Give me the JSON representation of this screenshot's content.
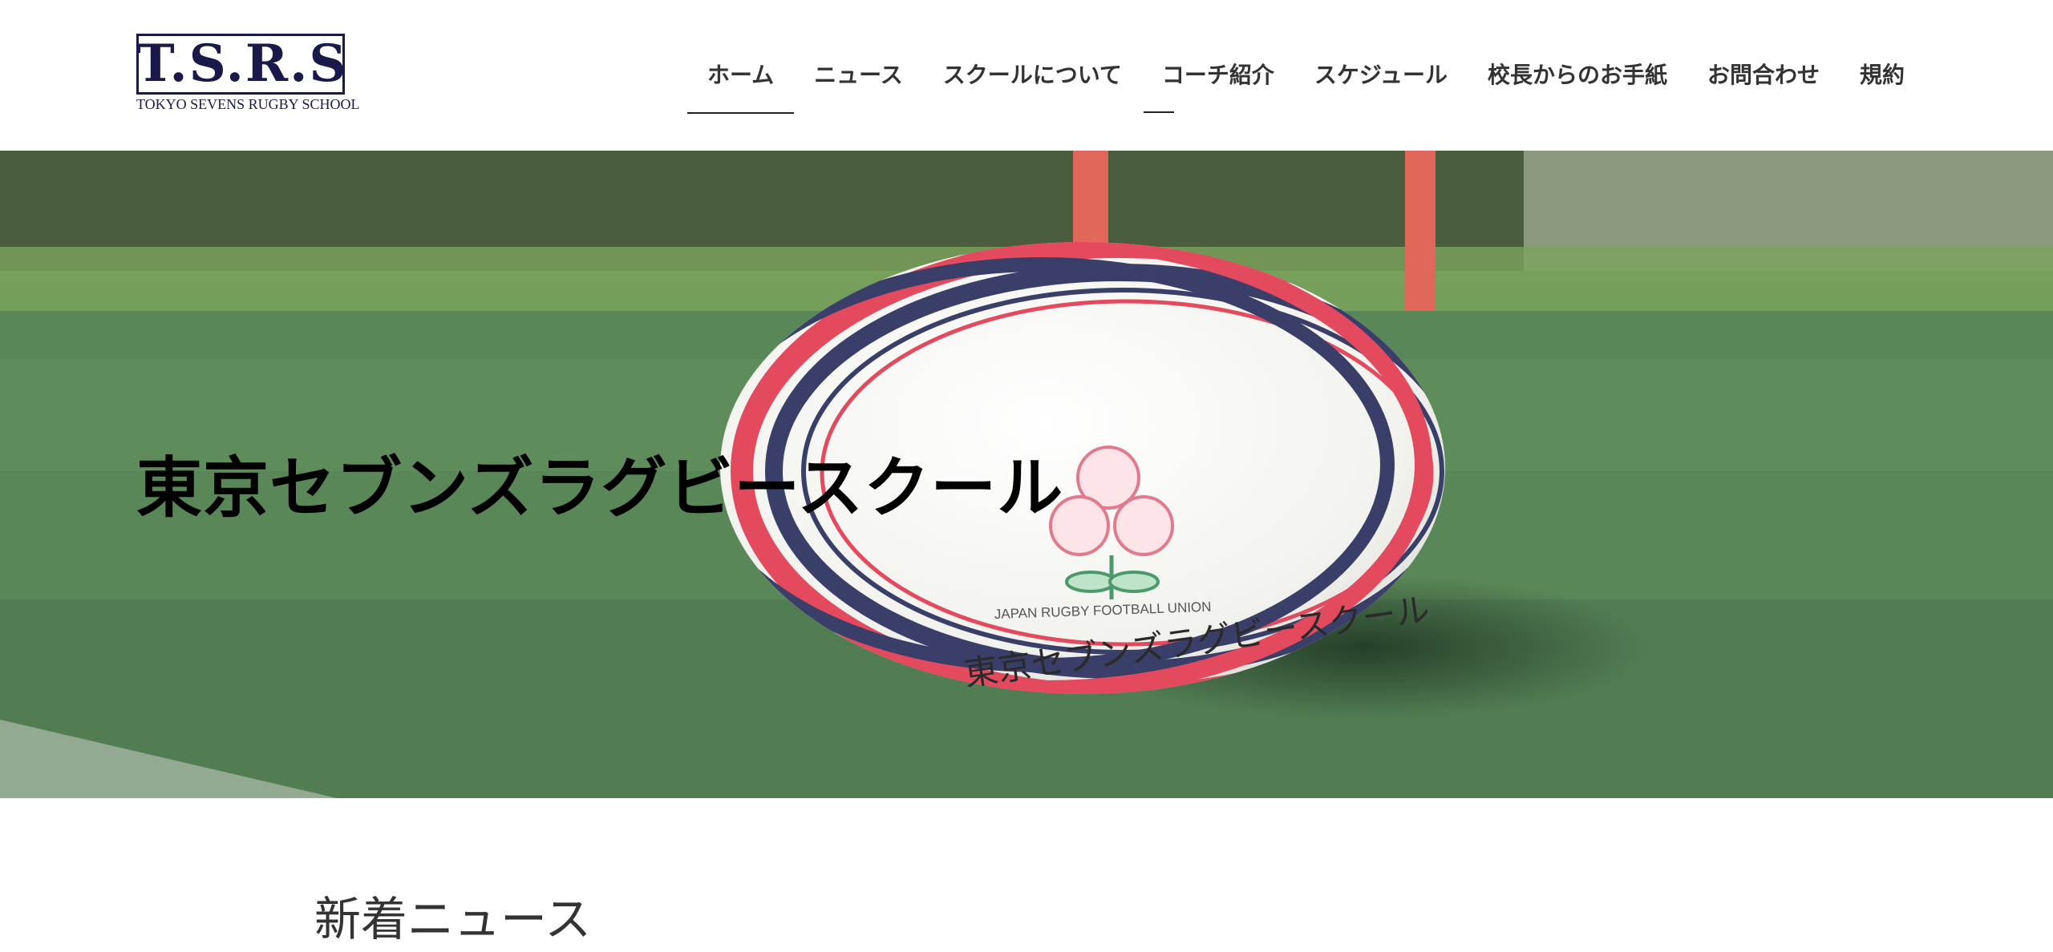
{
  "header": {
    "logo": {
      "letters": "T.S.R.S",
      "subtitle": "TOKYO SEVENS RUGBY SCHOOL"
    },
    "nav": [
      {
        "label": "ホーム",
        "active": true
      },
      {
        "label": "ニュース",
        "active": false
      },
      {
        "label": "スクールについて",
        "active": false
      },
      {
        "label": "コーチ紹介",
        "active": false
      },
      {
        "label": "スケジュール",
        "active": false
      },
      {
        "label": "校長からのお手紙",
        "active": false
      },
      {
        "label": "お問合わせ",
        "active": false
      },
      {
        "label": "規約",
        "active": false
      }
    ]
  },
  "hero": {
    "title": "東京セブンズラグビースクール",
    "ball": {
      "union_text": "JAPAN RUGBY FOOTBALL UNION",
      "handwriting": "東京セブンズラグビースクール"
    }
  },
  "news": {
    "heading": "新着ニュース"
  },
  "colors": {
    "logo_navy": "#1a1a4a",
    "grass": "#5a8757",
    "post": "#e0675a",
    "ball_red": "#e44a5e",
    "ball_navy": "#3a3f6a"
  }
}
